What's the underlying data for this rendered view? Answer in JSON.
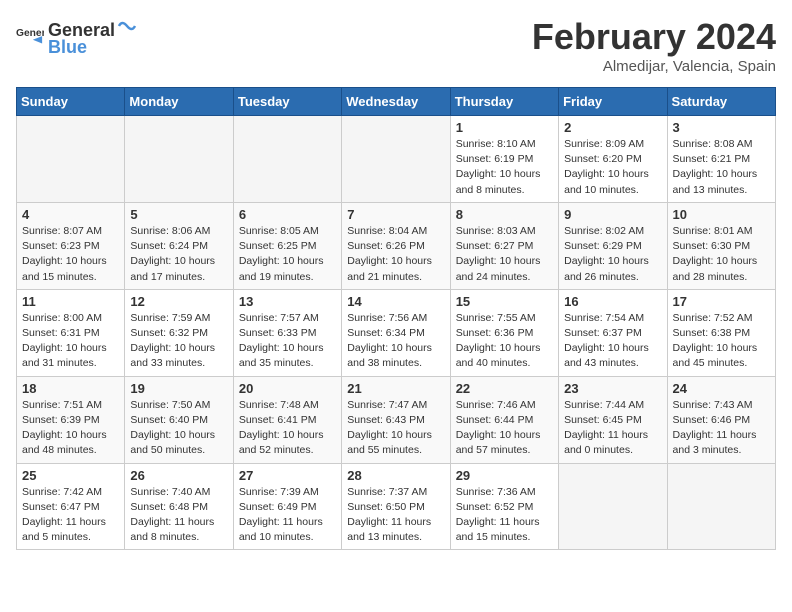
{
  "header": {
    "logo_general": "General",
    "logo_blue": "Blue",
    "month_title": "February 2024",
    "location": "Almedijar, Valencia, Spain"
  },
  "weekdays": [
    "Sunday",
    "Monday",
    "Tuesday",
    "Wednesday",
    "Thursday",
    "Friday",
    "Saturday"
  ],
  "weeks": [
    [
      {
        "day": "",
        "info": ""
      },
      {
        "day": "",
        "info": ""
      },
      {
        "day": "",
        "info": ""
      },
      {
        "day": "",
        "info": ""
      },
      {
        "day": "1",
        "info": "Sunrise: 8:10 AM\nSunset: 6:19 PM\nDaylight: 10 hours\nand 8 minutes."
      },
      {
        "day": "2",
        "info": "Sunrise: 8:09 AM\nSunset: 6:20 PM\nDaylight: 10 hours\nand 10 minutes."
      },
      {
        "day": "3",
        "info": "Sunrise: 8:08 AM\nSunset: 6:21 PM\nDaylight: 10 hours\nand 13 minutes."
      }
    ],
    [
      {
        "day": "4",
        "info": "Sunrise: 8:07 AM\nSunset: 6:23 PM\nDaylight: 10 hours\nand 15 minutes."
      },
      {
        "day": "5",
        "info": "Sunrise: 8:06 AM\nSunset: 6:24 PM\nDaylight: 10 hours\nand 17 minutes."
      },
      {
        "day": "6",
        "info": "Sunrise: 8:05 AM\nSunset: 6:25 PM\nDaylight: 10 hours\nand 19 minutes."
      },
      {
        "day": "7",
        "info": "Sunrise: 8:04 AM\nSunset: 6:26 PM\nDaylight: 10 hours\nand 21 minutes."
      },
      {
        "day": "8",
        "info": "Sunrise: 8:03 AM\nSunset: 6:27 PM\nDaylight: 10 hours\nand 24 minutes."
      },
      {
        "day": "9",
        "info": "Sunrise: 8:02 AM\nSunset: 6:29 PM\nDaylight: 10 hours\nand 26 minutes."
      },
      {
        "day": "10",
        "info": "Sunrise: 8:01 AM\nSunset: 6:30 PM\nDaylight: 10 hours\nand 28 minutes."
      }
    ],
    [
      {
        "day": "11",
        "info": "Sunrise: 8:00 AM\nSunset: 6:31 PM\nDaylight: 10 hours\nand 31 minutes."
      },
      {
        "day": "12",
        "info": "Sunrise: 7:59 AM\nSunset: 6:32 PM\nDaylight: 10 hours\nand 33 minutes."
      },
      {
        "day": "13",
        "info": "Sunrise: 7:57 AM\nSunset: 6:33 PM\nDaylight: 10 hours\nand 35 minutes."
      },
      {
        "day": "14",
        "info": "Sunrise: 7:56 AM\nSunset: 6:34 PM\nDaylight: 10 hours\nand 38 minutes."
      },
      {
        "day": "15",
        "info": "Sunrise: 7:55 AM\nSunset: 6:36 PM\nDaylight: 10 hours\nand 40 minutes."
      },
      {
        "day": "16",
        "info": "Sunrise: 7:54 AM\nSunset: 6:37 PM\nDaylight: 10 hours\nand 43 minutes."
      },
      {
        "day": "17",
        "info": "Sunrise: 7:52 AM\nSunset: 6:38 PM\nDaylight: 10 hours\nand 45 minutes."
      }
    ],
    [
      {
        "day": "18",
        "info": "Sunrise: 7:51 AM\nSunset: 6:39 PM\nDaylight: 10 hours\nand 48 minutes."
      },
      {
        "day": "19",
        "info": "Sunrise: 7:50 AM\nSunset: 6:40 PM\nDaylight: 10 hours\nand 50 minutes."
      },
      {
        "day": "20",
        "info": "Sunrise: 7:48 AM\nSunset: 6:41 PM\nDaylight: 10 hours\nand 52 minutes."
      },
      {
        "day": "21",
        "info": "Sunrise: 7:47 AM\nSunset: 6:43 PM\nDaylight: 10 hours\nand 55 minutes."
      },
      {
        "day": "22",
        "info": "Sunrise: 7:46 AM\nSunset: 6:44 PM\nDaylight: 10 hours\nand 57 minutes."
      },
      {
        "day": "23",
        "info": "Sunrise: 7:44 AM\nSunset: 6:45 PM\nDaylight: 11 hours\nand 0 minutes."
      },
      {
        "day": "24",
        "info": "Sunrise: 7:43 AM\nSunset: 6:46 PM\nDaylight: 11 hours\nand 3 minutes."
      }
    ],
    [
      {
        "day": "25",
        "info": "Sunrise: 7:42 AM\nSunset: 6:47 PM\nDaylight: 11 hours\nand 5 minutes."
      },
      {
        "day": "26",
        "info": "Sunrise: 7:40 AM\nSunset: 6:48 PM\nDaylight: 11 hours\nand 8 minutes."
      },
      {
        "day": "27",
        "info": "Sunrise: 7:39 AM\nSunset: 6:49 PM\nDaylight: 11 hours\nand 10 minutes."
      },
      {
        "day": "28",
        "info": "Sunrise: 7:37 AM\nSunset: 6:50 PM\nDaylight: 11 hours\nand 13 minutes."
      },
      {
        "day": "29",
        "info": "Sunrise: 7:36 AM\nSunset: 6:52 PM\nDaylight: 11 hours\nand 15 minutes."
      },
      {
        "day": "",
        "info": ""
      },
      {
        "day": "",
        "info": ""
      }
    ]
  ]
}
